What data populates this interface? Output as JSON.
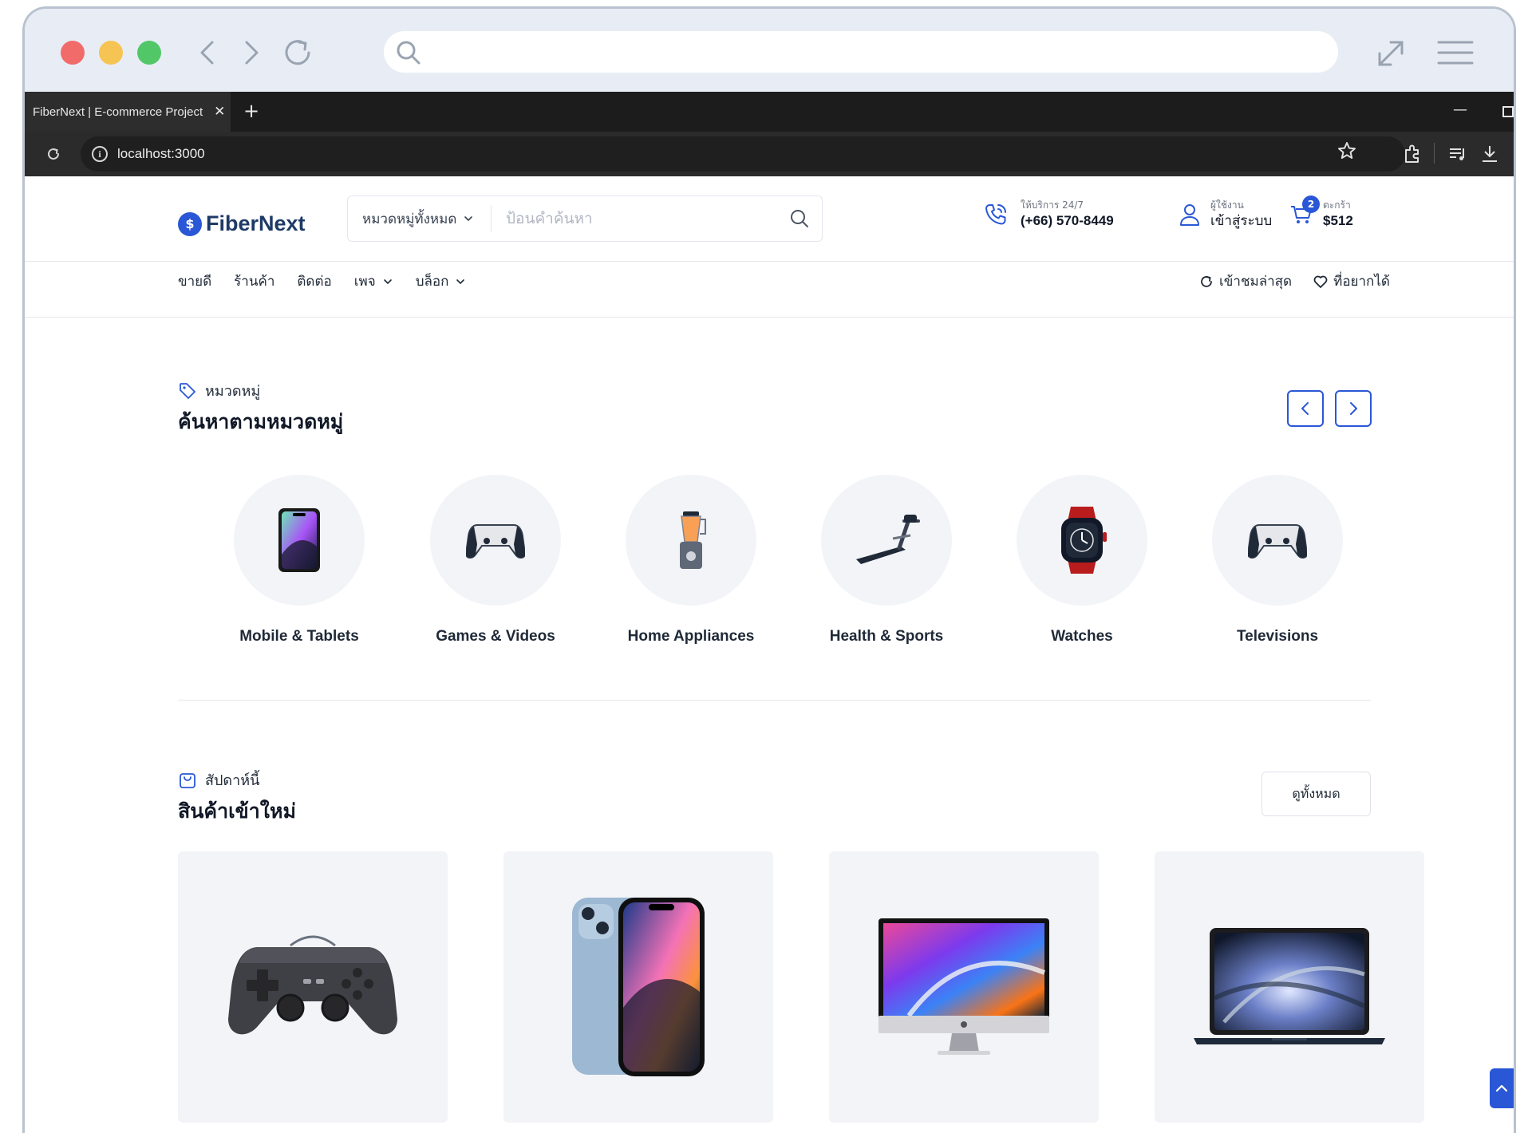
{
  "browser": {
    "tab_title": "FiberNext | E-commerce Project",
    "tab_close": "✕",
    "new_tab": "+",
    "address": "localhost:3000"
  },
  "header": {
    "logo_text": "FiberNext",
    "logo_mark": "$",
    "search": {
      "category": "หมวดหมู่ทั้งหมด",
      "placeholder": "ป้อนคำค้นหา"
    },
    "support": {
      "label": "ให้บริการ 24/7",
      "phone": "(+66) 570-8449"
    },
    "account": {
      "label": "ผู้ใช้งาน",
      "action": "เข้าสู่ระบบ"
    },
    "cart": {
      "label": "ตะกร้า",
      "total": "$512",
      "count": "2"
    }
  },
  "nav": {
    "items": [
      {
        "label": "ขายดี"
      },
      {
        "label": "ร้านค้า"
      },
      {
        "label": "ติดต่อ"
      },
      {
        "label": "เพจ"
      },
      {
        "label": "บล็อก"
      }
    ],
    "recent": "เข้าชมล่าสุด",
    "wishlist": "ที่อยากได้"
  },
  "categories": {
    "tag": "หมวดหมู่",
    "title": "ค้นหาตามหมวดหมู่",
    "items": [
      {
        "name": "Mobile & Tablets",
        "icon": "phone-icon"
      },
      {
        "name": "Games & Videos",
        "icon": "gamepad-icon"
      },
      {
        "name": "Home Appliances",
        "icon": "blender-icon"
      },
      {
        "name": "Health & Sports",
        "icon": "treadmill-icon"
      },
      {
        "name": "Watches",
        "icon": "watch-icon"
      },
      {
        "name": "Televisions",
        "icon": "gamepad-icon"
      }
    ]
  },
  "new_products": {
    "tag": "สัปดาห์นี้",
    "title": "สินค้าเข้าใหม่",
    "view_all": "ดูทั้งหมด",
    "items": [
      {
        "icon": "joystick-image"
      },
      {
        "icon": "iphone-image"
      },
      {
        "icon": "imac-image"
      },
      {
        "icon": "macbook-image"
      }
    ]
  },
  "colors": {
    "accent": "#2a57d6",
    "brand_text": "#1e3a66"
  }
}
